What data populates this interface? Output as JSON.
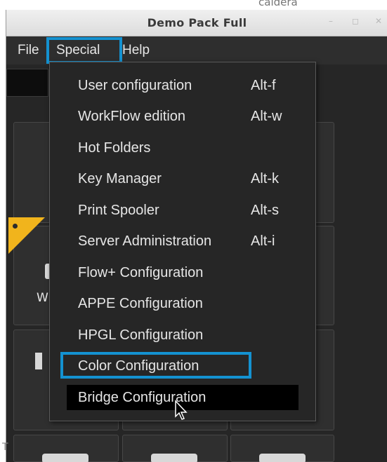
{
  "background_window_title": "caldera",
  "window": {
    "title": "Demo Pack Full",
    "minimize_glyph": "–",
    "maximize_glyph": "◻",
    "close_glyph": "✕"
  },
  "menubar": {
    "items": [
      {
        "label": "File"
      },
      {
        "label": "Special"
      },
      {
        "label": "Help"
      }
    ]
  },
  "dropdown": {
    "items": [
      {
        "label": "User configuration",
        "shortcut": "Alt-f"
      },
      {
        "label": "WorkFlow edition",
        "shortcut": "Alt-w"
      },
      {
        "label": "Hot Folders",
        "shortcut": ""
      },
      {
        "label": "Key Manager",
        "shortcut": "Alt-k"
      },
      {
        "label": "Print Spooler",
        "shortcut": "Alt-s"
      },
      {
        "label": "Server Administration",
        "shortcut": "Alt-i"
      },
      {
        "label": "Flow+ Configuration",
        "shortcut": ""
      },
      {
        "label": "APPE Configuration",
        "shortcut": ""
      },
      {
        "label": "HPGL Configuration",
        "shortcut": ""
      },
      {
        "label": "Color Configuration",
        "shortcut": ""
      },
      {
        "label": "Bridge Configuration",
        "shortcut": ""
      }
    ],
    "hovered_item": "Bridge Configuration",
    "highlighted_item": "Color Configuration"
  },
  "background": {
    "tile_label_fragment": "W",
    "edge_text": "T"
  },
  "colors": {
    "highlight_border": "#1492d1",
    "flag": "#f1b41c",
    "menu_bg": "#262626",
    "hover_bg": "#000000"
  }
}
